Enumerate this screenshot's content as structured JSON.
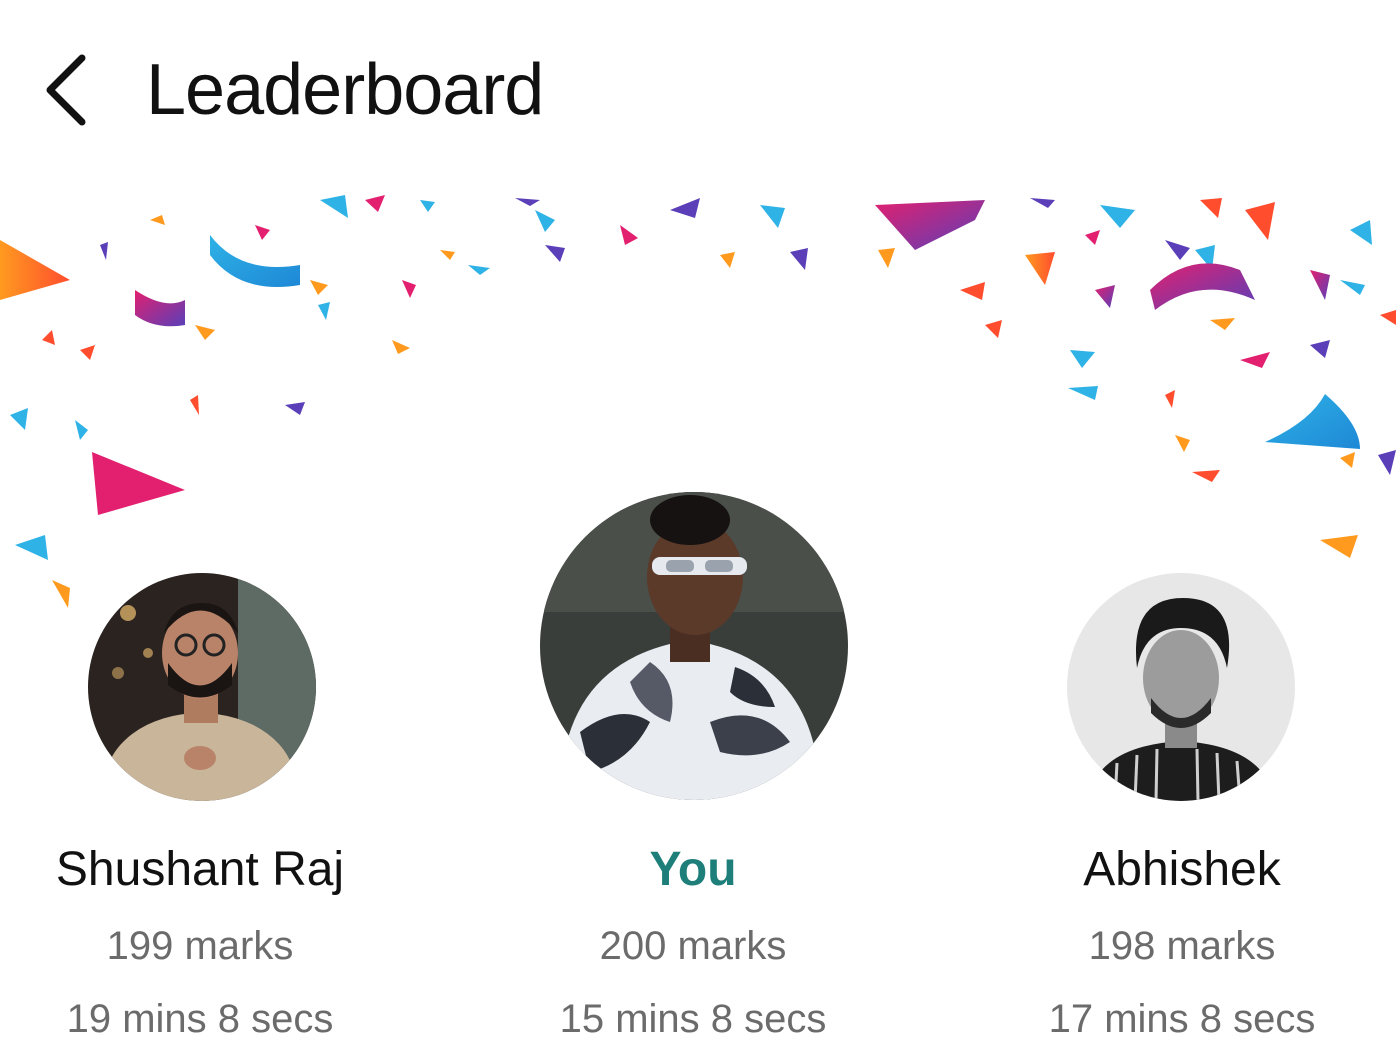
{
  "header": {
    "title": "Leaderboard",
    "back_icon": "chevron-left-icon"
  },
  "colors": {
    "accent_you": "#1e7f7a",
    "secondary_text": "#6b6b6b",
    "confetti": [
      "#e2206f",
      "#2fb2e6",
      "#ff9a1f",
      "#5a3fb8",
      "#ff4d2e"
    ]
  },
  "leaders": [
    {
      "name": "Shushant Raj",
      "marks": "199 marks",
      "time": "19 mins 8 secs",
      "avatar_icon": "user-photo-avatar"
    },
    {
      "name": "You",
      "marks": "200 marks",
      "time": "15 mins 8 secs",
      "avatar_icon": "user-photo-avatar"
    },
    {
      "name": "Abhishek",
      "marks": "198 marks",
      "time": "17 mins 8 secs",
      "avatar_icon": "user-photo-avatar"
    }
  ]
}
